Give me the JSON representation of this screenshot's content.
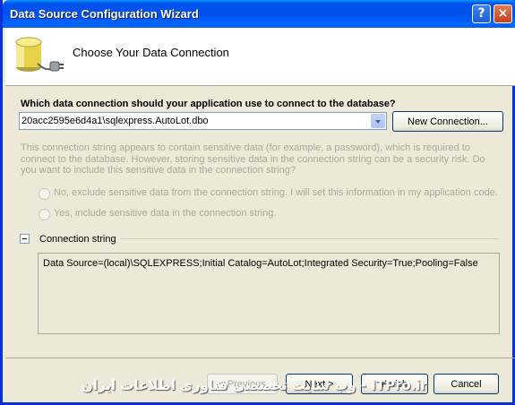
{
  "window": {
    "title": "Data Source Configuration Wizard",
    "help_label": "?",
    "close_label": "×"
  },
  "header": {
    "title": "Choose Your Data Connection",
    "icon": "database-plug-icon"
  },
  "connection": {
    "question": "Which data connection should your application use to connect to the database?",
    "selected": "20acc2595e6d4a1\\sqlexpress.AutoLot.dbo",
    "new_connection_label": "New Connection..."
  },
  "sensitive": {
    "info": "This connection string appears to contain sensitive data (for example, a password), which is required to connect to the database. However, storing sensitive data in the connection string can be a security risk. Do you want to include this sensitive data in the connection string?",
    "option_no": "No, exclude sensitive data from the connection string. I will set this information in my application code.",
    "option_yes": "Yes, include sensitive data in the connection string."
  },
  "connection_string": {
    "label": "Connection string",
    "value": "Data Source=(local)\\SQLEXPRESS;Initial Catalog=AutoLot;Integrated Security=True;Pooling=False"
  },
  "footer": {
    "previous_label": "< Previous",
    "next_label": "Next >",
    "finish_label": "Finish",
    "cancel_label": "Cancel",
    "watermark": "وب سایت تخصصی فناوری اطلاعات ایران - ITPro.ir"
  }
}
